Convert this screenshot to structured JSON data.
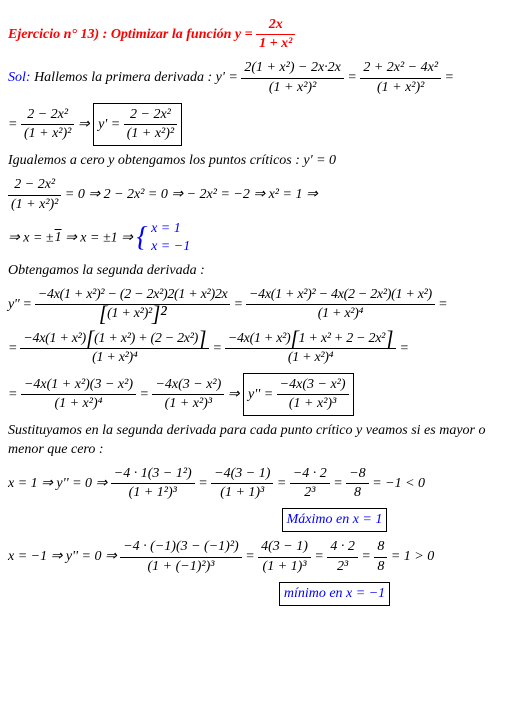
{
  "title_prefix": "Ejercicio n° 13) :",
  "title_text": " Optimizar la función ",
  "title_eq_lhs": "y =",
  "title_frac_num": "2x",
  "title_frac_den": "1 + x²",
  "sol_label": "Sol:",
  "sol_text": " Hallemos la primera derivada : ",
  "d1_lhs": "y' =",
  "d1_f1_num": "2(1 + x²) − 2x·2x",
  "d1_f1_den": "(1 + x²)²",
  "d1_eq": " = ",
  "d1_f2_num": "2 + 2x² − 4x²",
  "d1_f2_den": "(1 + x²)²",
  "d1_trail": " =",
  "d2_eq": "= ",
  "d2_f1_num": "2 − 2x²",
  "d2_f1_den": "(1 + x²)²",
  "d2_arrow": "  ⇒  ",
  "d2_box_lhs": "y' =",
  "d2_box_num": "2 − 2x²",
  "d2_box_den": "(1 + x²)²",
  "igual_text": "Igualemos a cero y obtengamos los puntos críticos : y' = 0",
  "cz_f_num": "2 − 2x²",
  "cz_f_den": "(1 + x²)²",
  "cz_seq": " = 0   ⇒ 2 − 2x² = 0   ⇒   − 2x² = −2   ⇒ x² = 1  ⇒",
  "cz2_seq": "⇒  x = ±",
  "cz2_sqrt": "1",
  "cz2_seq2": "  ⇒  x = ±1  ⇒ ",
  "cz2_case1": "x = 1",
  "cz2_case2": "x = −1",
  "second_text": "Obtengamos la segunda derivada :",
  "s1_lhs": "y'' =",
  "s1_f1_num": "−4x(1 + x²)² − (2 − 2x²)2(1 + x²)2x",
  "s1_f1_den_l": "[",
  "s1_f1_den_c": "(1 + x²)²",
  "s1_f1_den_r": "]²",
  "s1_eq": " = ",
  "s1_f2_num": "−4x(1 + x²)² − 4x(2 − 2x²)(1 + x²)",
  "s1_f2_den": "(1 + x²)⁴",
  "s1_trail": " =",
  "s2_eq": "= ",
  "s2_f1_num_a": "−4x(1 + x²)",
  "s2_f1_num_b": "(1 + x²) + (2 − 2x²)",
  "s2_f1_den": "(1 + x²)⁴",
  "s2_mid": " = ",
  "s2_f2_num_a": "−4x(1 + x²)",
  "s2_f2_num_b": "1 + x² + 2 − 2x²",
  "s2_f2_den": "(1 + x²)⁴",
  "s2_trail": " =",
  "s3_eq": "= ",
  "s3_f1_num": "−4x(1 + x²)(3 − x²)",
  "s3_f1_den": "(1 + x²)⁴",
  "s3_mid": " = ",
  "s3_f2_num": "−4x(3 − x²)",
  "s3_f2_den": "(1 + x²)³",
  "s3_arrow": "  ⇒  ",
  "s3_box_lhs": "y'' =",
  "s3_box_num": "−4x(3 − x²)",
  "s3_box_den": "(1 + x²)³",
  "sust_text": "Sustituyamos en la segunda derivada para cada punto crítico y veamos si es mayor o menor que cero :",
  "e1_lhs": "x = 1   ⇒   y'' = 0 ⇒ ",
  "e1_f1_num": "−4 · 1(3 − 1²)",
  "e1_f1_den": "(1 + 1²)³",
  "e1_m1": " = ",
  "e1_f2_num": "−4(3 − 1)",
  "e1_f2_den": "(1 + 1)³",
  "e1_m2": " = ",
  "e1_f3_num": "−4 · 2",
  "e1_f3_den": "2³",
  "e1_m3": " = ",
  "e1_f4_num": "−8",
  "e1_f4_den": "8",
  "e1_trail": " = −1 < 0",
  "e1_box": "Máximo en x = 1",
  "e2_lhs": "x = −1  ⇒  y'' = 0 ⇒ ",
  "e2_f1_num": "−4 · (−1)(3 − (−1)²)",
  "e2_f1_den": "(1 + (−1)²)³",
  "e2_m1": " = ",
  "e2_f2_num": "4(3 − 1)",
  "e2_f2_den": "(1 + 1)³",
  "e2_m2": " = ",
  "e2_f3_num": "4 · 2",
  "e2_f3_den": "2³",
  "e2_m3": " = ",
  "e2_f4_num": "8",
  "e2_f4_den": "8",
  "e2_trail": " = 1 > 0",
  "e2_box": "mínimo en x = −1"
}
